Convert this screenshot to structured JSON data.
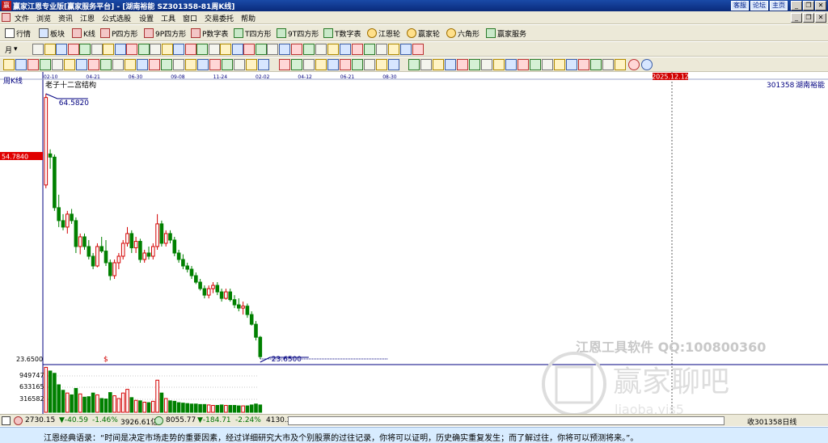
{
  "window": {
    "logo_glyph": "赢",
    "title": "赢家江恩专业版[赢家服务平台] - [湖南裕能  SZ301358-81周K线]",
    "links": [
      "客服",
      "论坛",
      "主页"
    ],
    "buttons": [
      "_",
      "❐",
      "✕"
    ],
    "mdi_buttons": [
      "_",
      "❐",
      "✕"
    ]
  },
  "menu": [
    "文件",
    "浏览",
    "资讯",
    "江恩",
    "公式选股",
    "设置",
    "工具",
    "窗口",
    "交易委托",
    "帮助"
  ],
  "toolbar": {
    "buttons": [
      "行情",
      "板块",
      "K线",
      "P四方形",
      "9P四方形",
      "P数字表",
      "T四方形",
      "9T四方形",
      "T数字表",
      "江恩轮",
      "赢家轮",
      "六角形",
      "赢家服务"
    ]
  },
  "toolbar2": {
    "period_label": "月",
    "period_arrow": "▾"
  },
  "chart": {
    "period_label": "周K线",
    "stock_code": "301358",
    "stock_name": "湖南裕能",
    "date_labels": [
      "02-10",
      "04-21",
      "06-30",
      "09-08",
      "11-24",
      "02-02",
      "04-12",
      "06-21",
      "08-30"
    ],
    "cursor_date": "2025.12.12",
    "structure_label": "老子十二宫结构",
    "high_label": "64.5820",
    "low_label": "23.6500",
    "cursor_price": "54.7840",
    "price_min_label": "23.6500",
    "marker": "$",
    "vol_labels": [
      "949747",
      "633165",
      "316582"
    ],
    "watermark_text": "江恩工具软件  QQ:100800360",
    "watermark_brand": "赢家聊吧",
    "watermark_url": "liaoba.yjs5",
    "colors": {
      "up": "#d40000",
      "down": "#008000",
      "axis": "#000080",
      "cursor_red": "#e00000"
    }
  },
  "chart_data": {
    "type": "candlestick",
    "title": "湖南裕能 301358 周K线",
    "x_tick_labels": [
      "02-10",
      "04-21",
      "06-30",
      "09-08",
      "11-24",
      "02-02",
      "04-12",
      "06-21",
      "08-30"
    ],
    "ylim": [
      23.65,
      64.58
    ],
    "annotations": {
      "high": 64.582,
      "low": 23.65,
      "cursor_price": 54.784,
      "cursor_date": "2025.12.12"
    },
    "volume_ticks": [
      316582,
      633165,
      949747
    ],
    "candles": [
      {
        "o": 50.5,
        "h": 64.6,
        "l": 50.0,
        "c": 64.0,
        "v": 980000
      },
      {
        "o": 55.3,
        "h": 56.0,
        "l": 53.0,
        "c": 54.8,
        "v": 900000
      },
      {
        "o": 54.8,
        "h": 55.2,
        "l": 46.5,
        "c": 47.0,
        "v": 850000
      },
      {
        "o": 47.0,
        "h": 49.0,
        "l": 44.0,
        "c": 45.0,
        "v": 600000
      },
      {
        "o": 45.0,
        "h": 46.0,
        "l": 43.5,
        "c": 44.0,
        "v": 480000
      },
      {
        "o": 44.0,
        "h": 46.5,
        "l": 43.0,
        "c": 46.0,
        "v": 420000
      },
      {
        "o": 46.0,
        "h": 46.8,
        "l": 44.5,
        "c": 45.0,
        "v": 380000
      },
      {
        "o": 45.0,
        "h": 45.5,
        "l": 40.0,
        "c": 41.0,
        "v": 520000
      },
      {
        "o": 41.0,
        "h": 43.0,
        "l": 39.8,
        "c": 42.5,
        "v": 400000
      },
      {
        "o": 42.5,
        "h": 43.0,
        "l": 40.5,
        "c": 41.0,
        "v": 330000
      },
      {
        "o": 41.0,
        "h": 42.0,
        "l": 39.0,
        "c": 39.5,
        "v": 340000
      },
      {
        "o": 39.5,
        "h": 40.0,
        "l": 37.5,
        "c": 38.0,
        "v": 420000
      },
      {
        "o": 38.0,
        "h": 41.5,
        "l": 37.8,
        "c": 41.0,
        "v": 380000
      },
      {
        "o": 41.0,
        "h": 42.5,
        "l": 40.0,
        "c": 40.3,
        "v": 300000
      },
      {
        "o": 40.3,
        "h": 42.0,
        "l": 38.0,
        "c": 38.5,
        "v": 290000
      },
      {
        "o": 38.5,
        "h": 39.0,
        "l": 35.8,
        "c": 36.5,
        "v": 430000
      },
      {
        "o": 36.5,
        "h": 39.0,
        "l": 36.0,
        "c": 38.5,
        "v": 360000
      },
      {
        "o": 38.5,
        "h": 40.0,
        "l": 37.5,
        "c": 39.5,
        "v": 300000
      },
      {
        "o": 39.5,
        "h": 42.0,
        "l": 39.0,
        "c": 41.5,
        "v": 420000
      },
      {
        "o": 41.5,
        "h": 44.0,
        "l": 41.0,
        "c": 43.0,
        "v": 500000
      },
      {
        "o": 43.0,
        "h": 43.5,
        "l": 40.0,
        "c": 40.8,
        "v": 320000
      },
      {
        "o": 40.8,
        "h": 42.5,
        "l": 40.0,
        "c": 41.8,
        "v": 260000
      },
      {
        "o": 41.8,
        "h": 42.2,
        "l": 38.5,
        "c": 39.0,
        "v": 250000
      },
      {
        "o": 39.0,
        "h": 40.5,
        "l": 38.5,
        "c": 40.0,
        "v": 220000
      },
      {
        "o": 40.0,
        "h": 41.0,
        "l": 39.0,
        "c": 39.5,
        "v": 210000
      },
      {
        "o": 39.5,
        "h": 41.5,
        "l": 39.0,
        "c": 41.0,
        "v": 240000
      },
      {
        "o": 41.0,
        "h": 46.0,
        "l": 40.5,
        "c": 44.5,
        "v": 700000
      },
      {
        "o": 44.5,
        "h": 45.0,
        "l": 41.0,
        "c": 41.5,
        "v": 420000
      },
      {
        "o": 41.5,
        "h": 43.5,
        "l": 41.0,
        "c": 43.0,
        "v": 300000
      },
      {
        "o": 43.0,
        "h": 43.5,
        "l": 41.5,
        "c": 42.0,
        "v": 250000
      },
      {
        "o": 42.0,
        "h": 42.5,
        "l": 39.5,
        "c": 40.0,
        "v": 240000
      },
      {
        "o": 40.0,
        "h": 40.5,
        "l": 38.5,
        "c": 39.0,
        "v": 210000
      },
      {
        "o": 39.0,
        "h": 39.8,
        "l": 37.5,
        "c": 38.0,
        "v": 200000
      },
      {
        "o": 38.0,
        "h": 38.5,
        "l": 37.0,
        "c": 37.5,
        "v": 190000
      },
      {
        "o": 37.5,
        "h": 38.0,
        "l": 36.0,
        "c": 36.5,
        "v": 180000
      },
      {
        "o": 36.5,
        "h": 37.0,
        "l": 35.2,
        "c": 35.5,
        "v": 180000
      },
      {
        "o": 35.5,
        "h": 36.0,
        "l": 34.2,
        "c": 34.5,
        "v": 170000
      },
      {
        "o": 34.5,
        "h": 35.0,
        "l": 33.0,
        "c": 33.5,
        "v": 170000
      },
      {
        "o": 33.5,
        "h": 35.0,
        "l": 33.0,
        "c": 34.5,
        "v": 160000
      },
      {
        "o": 34.5,
        "h": 35.5,
        "l": 33.8,
        "c": 35.0,
        "v": 150000
      },
      {
        "o": 35.0,
        "h": 35.5,
        "l": 33.5,
        "c": 34.0,
        "v": 150000
      },
      {
        "o": 34.0,
        "h": 34.5,
        "l": 32.5,
        "c": 33.0,
        "v": 160000
      },
      {
        "o": 33.0,
        "h": 34.5,
        "l": 32.8,
        "c": 34.0,
        "v": 150000
      },
      {
        "o": 34.0,
        "h": 34.5,
        "l": 32.5,
        "c": 32.8,
        "v": 150000
      },
      {
        "o": 32.8,
        "h": 33.5,
        "l": 31.5,
        "c": 32.0,
        "v": 150000
      },
      {
        "o": 32.0,
        "h": 33.0,
        "l": 31.0,
        "c": 31.5,
        "v": 140000
      },
      {
        "o": 31.5,
        "h": 32.5,
        "l": 30.5,
        "c": 31.8,
        "v": 140000
      },
      {
        "o": 31.8,
        "h": 32.2,
        "l": 30.0,
        "c": 30.5,
        "v": 140000
      },
      {
        "o": 30.5,
        "h": 31.0,
        "l": 28.8,
        "c": 29.0,
        "v": 160000
      },
      {
        "o": 29.0,
        "h": 29.5,
        "l": 26.5,
        "c": 27.0,
        "v": 180000
      },
      {
        "o": 27.0,
        "h": 27.2,
        "l": 23.65,
        "c": 24.0,
        "v": 160000
      }
    ]
  },
  "tabbar": {
    "idx1_value": "2730.15",
    "idx1_change": "▼-40.59",
    "idx1_pct": "-1.46%",
    "idx1_amount": "3926.61亿",
    "idx2_value": "8055.77",
    "idx2_change": "▼-184.71",
    "idx2_pct": "-2.24%",
    "idx2_amount": "4130.2",
    "right_label": "收301358日线"
  },
  "quote": "江恩经典语录：“时间是决定市场走势的重要因素，经过详细研究大市及个别股票的过往记录，你将可以证明，历史确实重复发生；而了解过往，你将可以预测将来。”。"
}
